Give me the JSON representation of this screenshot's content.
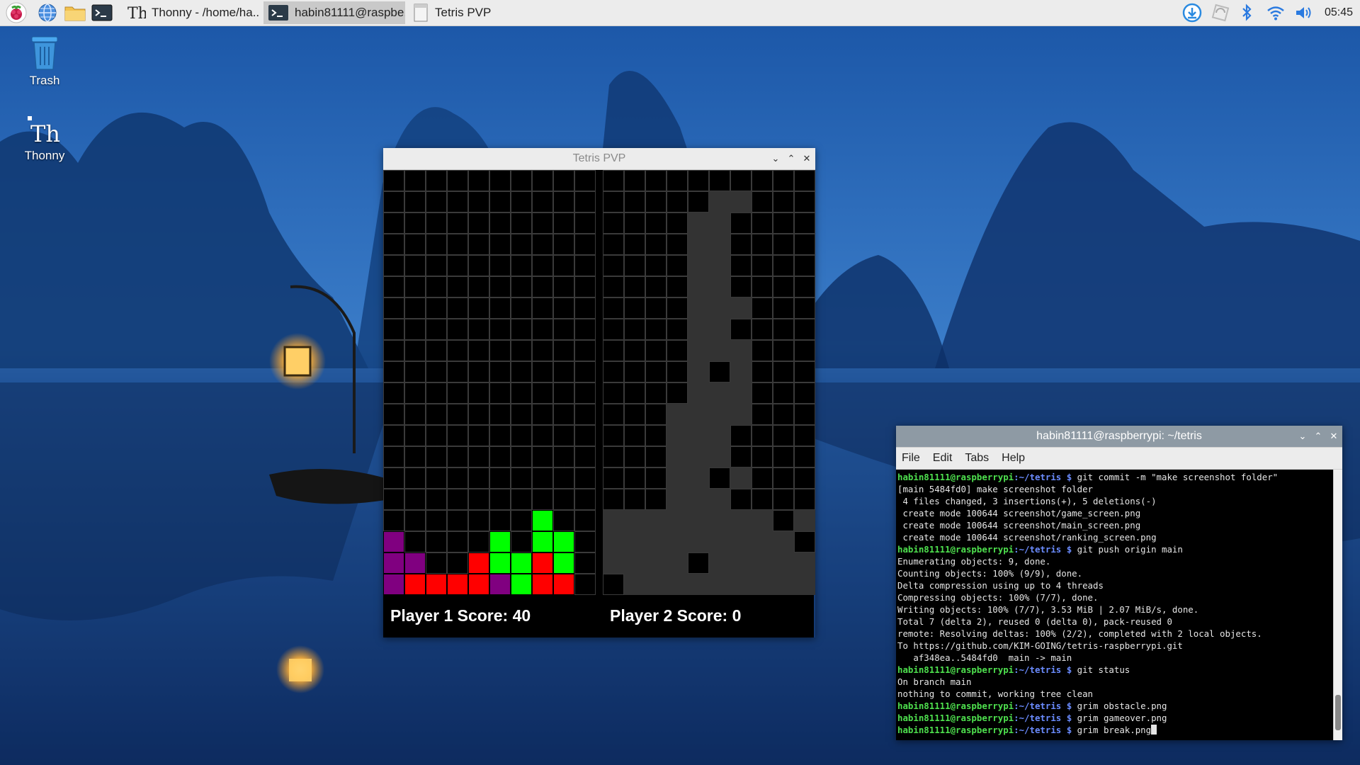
{
  "taskbar": {
    "tasks": [
      {
        "label": "Thonny  -  /home/ha..",
        "icon": "thonny-icon"
      },
      {
        "label": "habin81111@raspbe..",
        "icon": "terminal-icon"
      },
      {
        "label": "Tetris PVP",
        "icon": "window-icon"
      }
    ],
    "clock": "05:45"
  },
  "desktop": {
    "icons": [
      {
        "label": "Trash",
        "icon": "trash-icon"
      },
      {
        "label": "Thonny",
        "icon": "thonny-icon"
      }
    ]
  },
  "tetris": {
    "title": "Tetris PVP",
    "player1_score": "Player 1 Score: 40",
    "player2_score": "Player 2 Score: 0",
    "colors": {
      "empty": "#000000",
      "grid": "#3a3a3a",
      "purple": "#800080",
      "red": "#ff0000",
      "green": "#00ff00",
      "gray": "#333333"
    },
    "board1": [
      "..........",
      "..........",
      "..........",
      "..........",
      "..........",
      "..........",
      "..........",
      "..........",
      "..........",
      "..........",
      "..........",
      "..........",
      "..........",
      "..........",
      "..........",
      "..........",
      ".......G..",
      "P....G.GG.",
      "PP..RGGRG.",
      "PRRRRPGRR."
    ],
    "board2": [
      "..........",
      ".....XX...",
      "....XX....",
      "....XX....",
      "....XX....",
      "....XX....",
      "....XXX...",
      "....XX....",
      "....XXX...",
      "....X.X...",
      "....XXX...",
      "...XXXX...",
      "...XXX....",
      "...XXX....",
      "...XX.X...",
      "...XXX....",
      "XXXXXXXX.X",
      "XXXXXXXXX.",
      "XXXX.XXXXX",
      ".XXXXXXXXX"
    ]
  },
  "terminal": {
    "title": "habin81111@raspberrypi: ~/tetris",
    "menu": [
      "File",
      "Edit",
      "Tabs",
      "Help"
    ],
    "prompt_user": "habin81111@raspberrypi",
    "prompt_path": ":~/tetris $",
    "lines": [
      {
        "prompt": true,
        "text": " git commit -m \"make screenshot folder\""
      },
      {
        "prompt": false,
        "text": "[main 5484fd0] make screenshot folder"
      },
      {
        "prompt": false,
        "text": " 4 files changed, 3 insertions(+), 5 deletions(-)"
      },
      {
        "prompt": false,
        "text": " create mode 100644 screenshot/game_screen.png"
      },
      {
        "prompt": false,
        "text": " create mode 100644 screenshot/main_screen.png"
      },
      {
        "prompt": false,
        "text": " create mode 100644 screenshot/ranking_screen.png"
      },
      {
        "prompt": true,
        "text": " git push origin main"
      },
      {
        "prompt": false,
        "text": "Enumerating objects: 9, done."
      },
      {
        "prompt": false,
        "text": "Counting objects: 100% (9/9), done."
      },
      {
        "prompt": false,
        "text": "Delta compression using up to 4 threads"
      },
      {
        "prompt": false,
        "text": "Compressing objects: 100% (7/7), done."
      },
      {
        "prompt": false,
        "text": "Writing objects: 100% (7/7), 3.53 MiB | 2.07 MiB/s, done."
      },
      {
        "prompt": false,
        "text": "Total 7 (delta 2), reused 0 (delta 0), pack-reused 0"
      },
      {
        "prompt": false,
        "text": "remote: Resolving deltas: 100% (2/2), completed with 2 local objects."
      },
      {
        "prompt": false,
        "text": "To https://github.com/KIM-GOING/tetris-raspberrypi.git"
      },
      {
        "prompt": false,
        "text": "   af348ea..5484fd0  main -> main"
      },
      {
        "prompt": true,
        "text": " git status"
      },
      {
        "prompt": false,
        "text": "On branch main"
      },
      {
        "prompt": false,
        "text": "nothing to commit, working tree clean"
      },
      {
        "prompt": true,
        "text": " grim obstacle.png"
      },
      {
        "prompt": true,
        "text": " grim gameover.png"
      },
      {
        "prompt": true,
        "text": " grim break.png",
        "cursor": true
      }
    ]
  }
}
